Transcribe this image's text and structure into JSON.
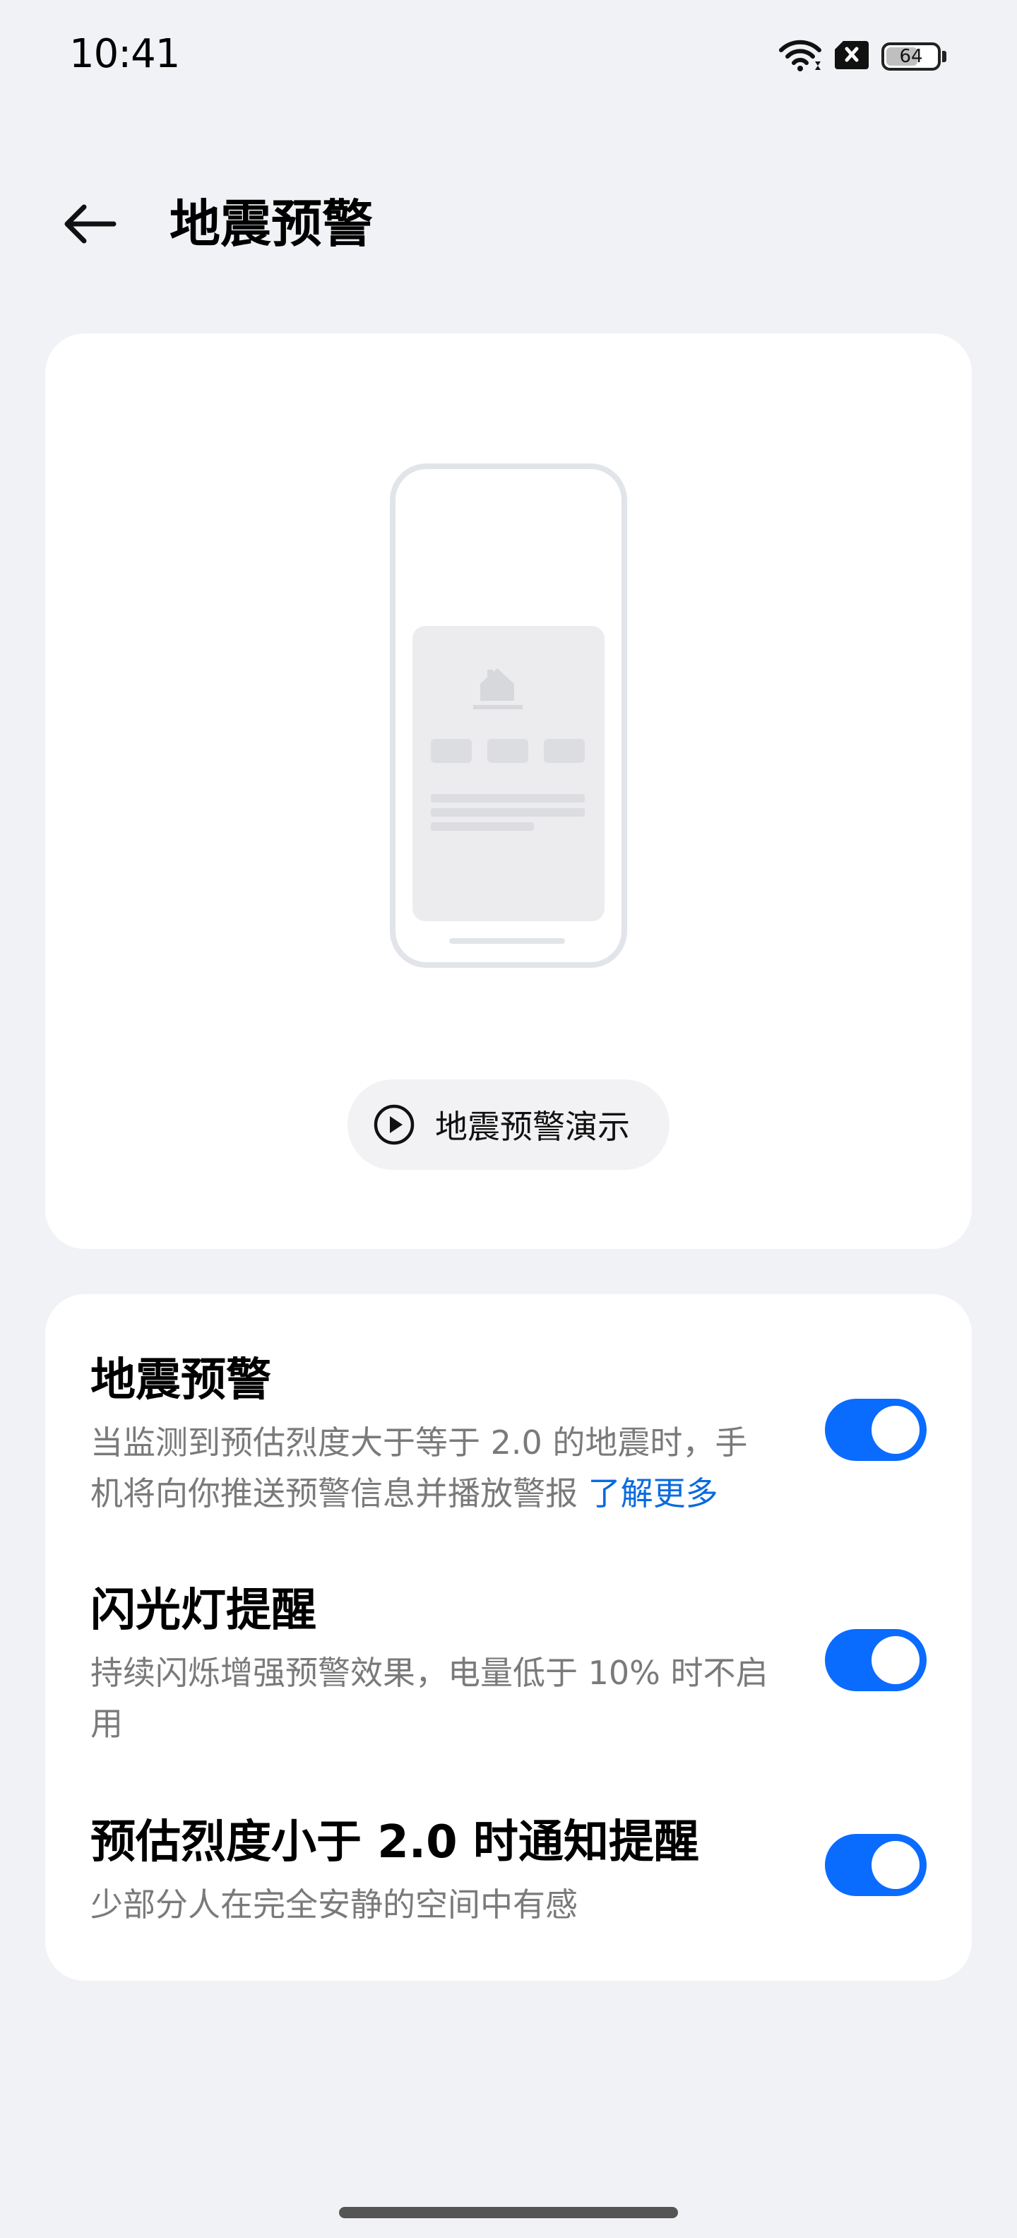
{
  "status_bar": {
    "time": "10:41",
    "battery_level": "64",
    "icons": [
      "wifi-icon",
      "no-sim-icon",
      "battery-icon"
    ]
  },
  "header": {
    "title": "地震预警",
    "back_icon": "arrow-left-icon"
  },
  "illustration": {
    "demo_button_label": "地震预警演示",
    "demo_icon": "play-circle-icon"
  },
  "settings": [
    {
      "title": "地震预警",
      "description": "当监测到预估烈度大于等于 2.0 的地震时，手机将向你推送预警信息并播放警报",
      "link": "了解更多",
      "enabled": true
    },
    {
      "title": "闪光灯提醒",
      "description": "持续闪烁增强预警效果，电量低于 10% 时不启用",
      "enabled": true
    },
    {
      "title": "预估烈度小于 2.0 时通知提醒",
      "description": "少部分人在完全安静的空间中有感",
      "enabled": true
    }
  ],
  "colors": {
    "accent": "#0a6bff",
    "link": "#0a6bde",
    "background": "#f1f2f5",
    "card": "#ffffff"
  }
}
